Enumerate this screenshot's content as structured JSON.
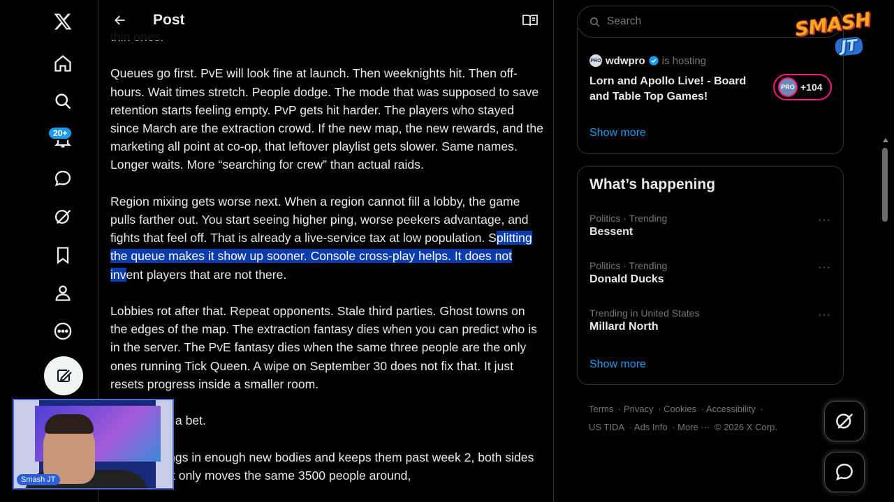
{
  "header": {
    "title": "Post"
  },
  "post": {
    "paragraphs": [
      {
        "parts": [
          {
            "text": "thin ones.",
            "hl": false
          }
        ]
      },
      {
        "parts": [
          {
            "text": "Queues go first. PvE will look fine at launch. Then weeknights hit. Then off-hours. Wait times stretch. People dodge. The mode that was supposed to save retention starts feeling empty. PvP gets hit harder. The players who stayed since March are the extraction crowd. If the new map, the new rewards, and the marketing all point at co-op, that leftover playlist gets slower. Same names. Longer waits. More “searching for crew” than actual raids.",
            "hl": false
          }
        ]
      },
      {
        "parts": [
          {
            "text": "Region mixing gets worse next. When a region cannot fill a lobby, the game pulls farther out. You start seeing higher ping, worse peekers advantage, and fights that feel off. That is already a live-service tax at low population. S",
            "hl": false
          },
          {
            "text": "plitting the queue makes it show up sooner. Console cross-play helps. It does not inv",
            "hl": true
          },
          {
            "text": "ent players that are not there.",
            "hl": false
          }
        ]
      },
      {
        "parts": [
          {
            "text": "Lobbies rot after that. Repeat opponents. Stale third parties. Ghost towns on the edges of the map. The extraction fantasy dies when you can predict who is in the server. The PvE fantasy dies when the same three people are the only ones running Tick Queen. A wipe on September 30 does not fix that. It just resets progress inside a smaller room.",
            "hl": false
          }
        ]
      },
      {
        "parts": [
          {
            "text": "So co-op is a bet.",
            "hl": false
          }
        ]
      },
      {
        "parts": [
          {
            "text": "If co-op brings in enough new bodies and keeps them past week 2, both sides can live. If it only moves the same 3500 people around,",
            "hl": false
          }
        ]
      }
    ]
  },
  "nav": {
    "notifications_badge": "20+",
    "items": [
      "home",
      "explore",
      "notifications",
      "messages",
      "grok",
      "bookmarks",
      "profile",
      "more"
    ]
  },
  "search": {
    "placeholder": "Search"
  },
  "space": {
    "host": "wdwpro",
    "hosting_label": "is hosting",
    "host_logo_text": "PRO",
    "title": "Lorn and Apollo Live! - Board and Table Top Games!",
    "listener_count": "+104",
    "show_more": "Show more"
  },
  "happening": {
    "title": "What’s happening",
    "trends": [
      {
        "meta": "Politics · Trending",
        "name": "Bessent"
      },
      {
        "meta": "Politics · Trending",
        "name": "Donald Ducks"
      },
      {
        "meta": "Trending in United States",
        "name": "Millard North"
      }
    ],
    "show_more": "Show more"
  },
  "footer": {
    "links": [
      "Terms",
      "Privacy",
      "Cookies",
      "Accessibility",
      "US TIDA",
      "Ads Info",
      "More ···"
    ],
    "copyright": "© 2026 X Corp."
  },
  "overlay": {
    "logo_top": "SMASH",
    "logo_bottom": "JT",
    "cam_label": "Smash JT"
  },
  "colors": {
    "accent": "#1d9bf0",
    "highlight": "#0b3cae",
    "pill_border": "#f91880"
  }
}
